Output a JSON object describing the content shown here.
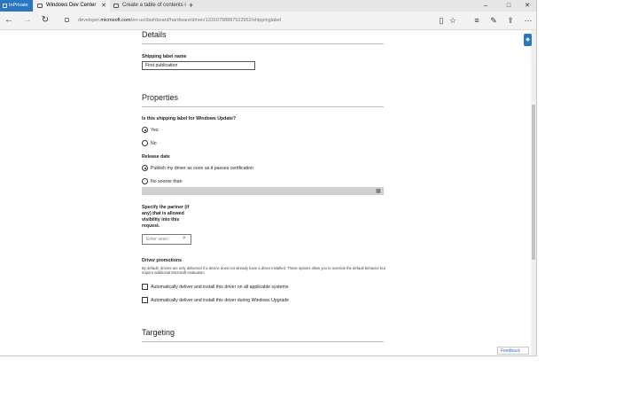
{
  "browser": {
    "inprivate_label": "InPrivate",
    "tabs": [
      {
        "title": "Windows Dev Center",
        "close": "✕"
      },
      {
        "title": "Create a table of contents ir"
      }
    ],
    "new_tab": "+",
    "window_controls": {
      "minimize": "–",
      "maximize": "□",
      "close": "✕"
    },
    "nav": {
      "back": "←",
      "forward": "→",
      "refresh": "↻"
    },
    "url": {
      "prefix": "developer.",
      "domain": "microsoft.com",
      "path": "/en-us/dashboard/hardware/driver/13310798887522952/shippinglabel"
    },
    "toolbar_icons": [
      "reading-view",
      "favorites-star",
      "hub",
      "web-note",
      "share",
      "more"
    ]
  },
  "page": {
    "details": {
      "heading": "Details",
      "shipping_label_name_label": "Shipping label name",
      "shipping_label_name_value": "First publication"
    },
    "properties": {
      "heading": "Properties",
      "windows_update_question": "Is this shipping label for Windows Update?",
      "wu_options": [
        {
          "label": "Yes",
          "selected": true
        },
        {
          "label": "No",
          "selected": false
        }
      ],
      "release_date_label": "Release date",
      "release_options": [
        {
          "label": "Publish my driver as soon as it passes certification",
          "selected": true
        },
        {
          "label": "No sooner than",
          "selected": false
        }
      ],
      "partner_label_lines": [
        "Specify the partner (if",
        "any) that is allowed",
        "visibility into this",
        "request."
      ],
      "search_placeholder": "Enter searc",
      "driver_promotions_label": "Driver promotions",
      "driver_promotions_desc": "By default, drivers are only delivered if a device does not already have a driver installed. These options allow you to override the default behavior but require additional Microsoft evaluation.",
      "promotion_options": [
        {
          "label": "Automatically deliver and install this driver on all applicable systems",
          "checked": false
        },
        {
          "label": "Automatically deliver and install this driver during Windows Upgrade",
          "checked": false
        }
      ]
    },
    "targeting": {
      "heading": "Targeting"
    },
    "feedback_label": "Feedback"
  }
}
